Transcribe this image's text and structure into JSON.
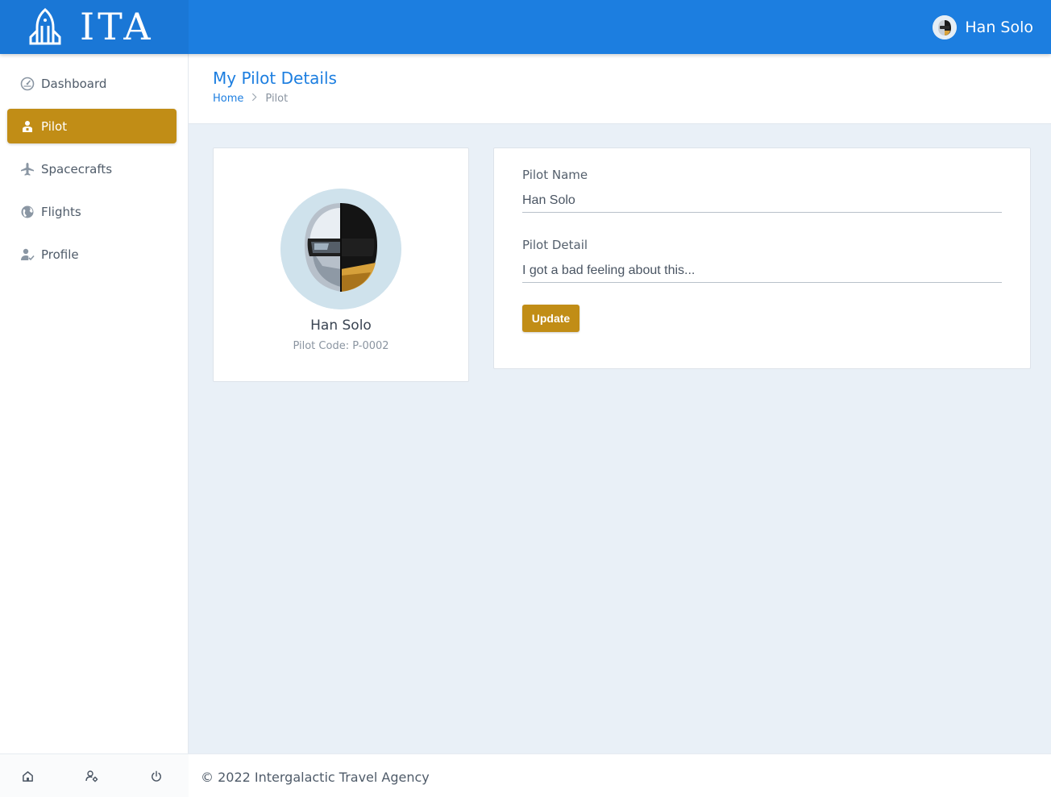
{
  "brand": {
    "name": "ITA",
    "logo_icon": "rocket-icon"
  },
  "header": {
    "user_name": "Han Solo",
    "avatar_icon": "helmet-avatar-icon"
  },
  "sidebar": {
    "items": [
      {
        "label": "Dashboard",
        "icon": "speedometer-icon",
        "active": false
      },
      {
        "label": "Pilot",
        "icon": "pilot-icon",
        "active": true
      },
      {
        "label": "Spacecrafts",
        "icon": "airplane-icon",
        "active": false
      },
      {
        "label": "Flights",
        "icon": "globe-icon",
        "active": false
      },
      {
        "label": "Profile",
        "icon": "user-check-icon",
        "active": false
      }
    ],
    "footer_icons": [
      "home-icon",
      "user-settings-icon",
      "power-icon"
    ]
  },
  "page": {
    "title": "My Pilot Details",
    "breadcrumb": {
      "home": "Home",
      "separator": ">",
      "current": "Pilot"
    }
  },
  "profile_card": {
    "name": "Han Solo",
    "code": "Pilot Code: P-0002"
  },
  "form": {
    "name_label": "Pilot Name",
    "name_value": "Han Solo",
    "detail_label": "Pilot Detail",
    "detail_value": "I got a bad feeling about this...",
    "update_label": "Update"
  },
  "footer": {
    "copyright": "© 2022 Intergalactic Travel Agency"
  },
  "colors": {
    "primary": "#1c7ee0",
    "accent": "#c18d16",
    "background": "#e9f0f7"
  }
}
